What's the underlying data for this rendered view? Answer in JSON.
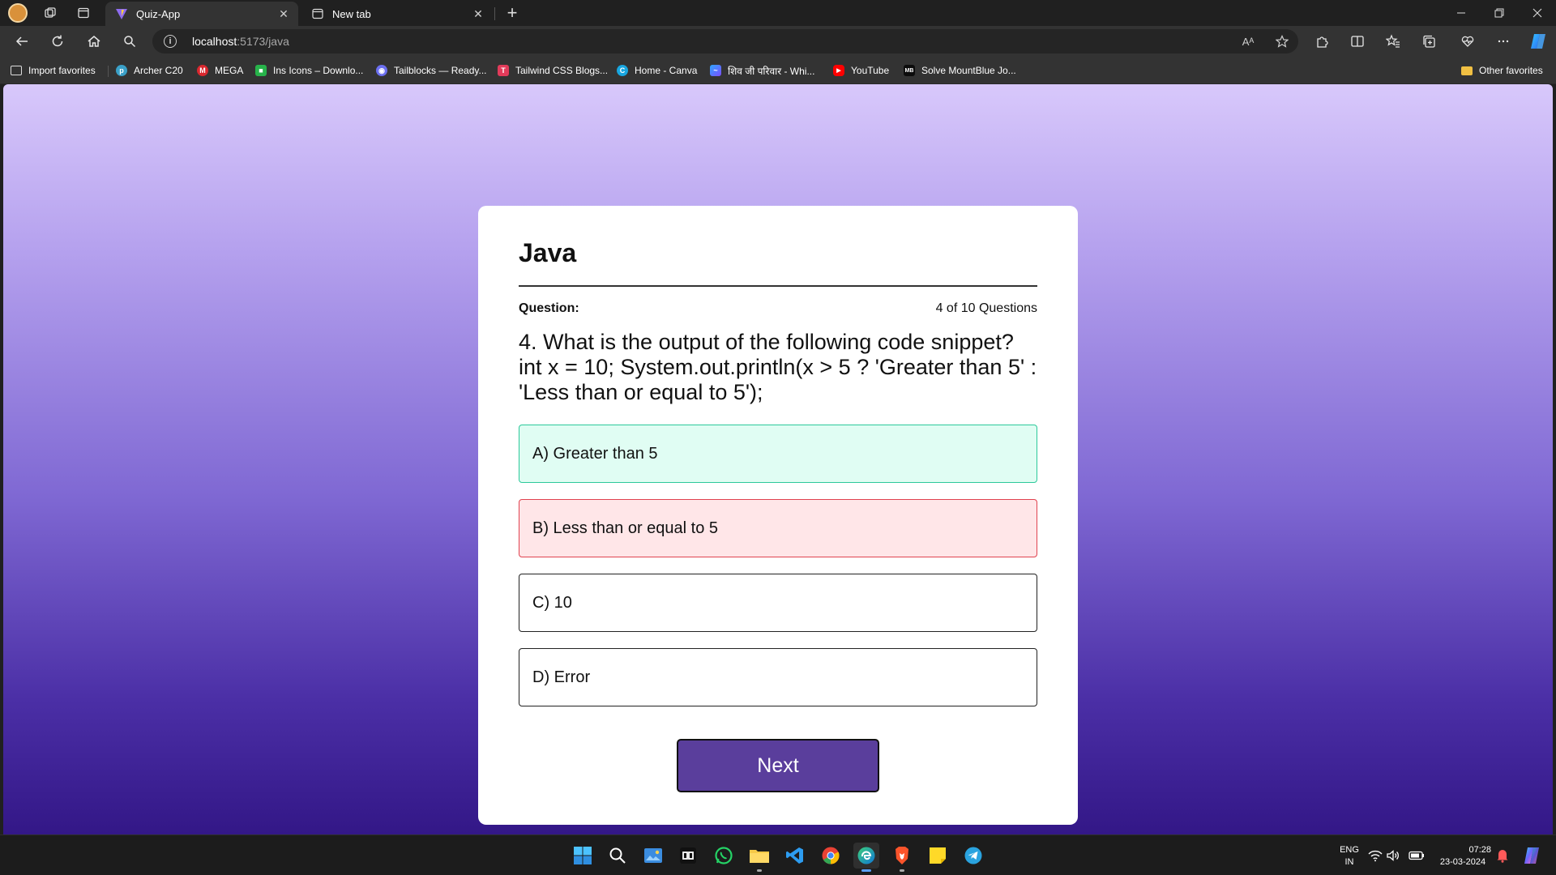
{
  "browser": {
    "tabs": [
      {
        "title": "Quiz-App",
        "active": true
      },
      {
        "title": "New tab",
        "active": false
      }
    ],
    "address": {
      "host": "localhost",
      "rest": ":5173/java"
    },
    "read_aloud_label": "Aᴬ",
    "bookmarks": [
      {
        "label": "Import favorites",
        "icon": "import-icon"
      },
      {
        "label": "Archer C20",
        "icon": "tplink-icon"
      },
      {
        "label": "MEGA",
        "icon": "mega-icon"
      },
      {
        "label": "Ins Icons – Downlo...",
        "icon": "insicons-icon"
      },
      {
        "label": "Tailblocks — Ready...",
        "icon": "tailblocks-icon"
      },
      {
        "label": "Tailwind CSS Blogs...",
        "icon": "tailwind-icon"
      },
      {
        "label": "Home - Canva",
        "icon": "canva-icon"
      },
      {
        "label": "शिव जी परिवार - Whi...",
        "icon": "whimsical-icon"
      },
      {
        "label": "YouTube",
        "icon": "youtube-icon"
      },
      {
        "label": "Solve MountBlue Jo...",
        "icon": "mountblue-icon"
      }
    ],
    "other_favorites": "Other favorites"
  },
  "quiz": {
    "title": "Java",
    "question_label": "Question:",
    "counter": "4 of 10 Questions",
    "question": "4. What is the output of the following code snippet? int x = 10; System.out.println(x > 5 ? 'Greater than 5' : 'Less than or equal to 5');",
    "options": [
      {
        "label": "A) Greater than 5",
        "state": "correct"
      },
      {
        "label": "B) Less than or equal to 5",
        "state": "wrong"
      },
      {
        "label": "C) 10",
        "state": "none"
      },
      {
        "label": "D) Error",
        "state": "none"
      }
    ],
    "next_label": "Next"
  },
  "colors": {
    "correct_bg": "#e0fdf3",
    "correct_border": "#2cc99a",
    "wrong_bg": "#ffe6e8",
    "wrong_border": "#e0424f",
    "button": "#5a3e9c"
  },
  "taskbar": {
    "language": "ENG",
    "region": "IN",
    "time": "07:28",
    "date": "23-03-2024"
  }
}
